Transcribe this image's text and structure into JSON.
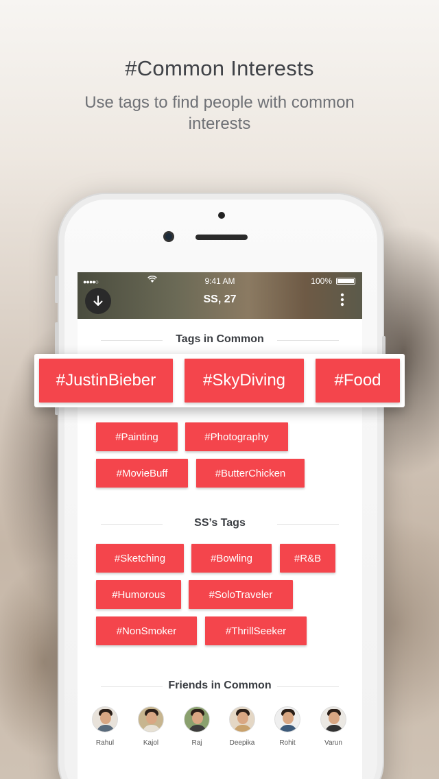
{
  "headline": "#Common Interests",
  "subline": "Use tags to find people with common interests",
  "status_bar": {
    "signal": "●●●●○",
    "time": "9:41 AM",
    "battery": "100%"
  },
  "header": {
    "title": "SS, 27"
  },
  "sections": {
    "common_title": "Tags in Common",
    "user_tags_title": "SS’s Tags",
    "friends_title": "Friends in Common"
  },
  "highlight_tags": [
    "#JustinBieber",
    "#SkyDiving",
    "#Food"
  ],
  "common_tags": [
    "#Painting",
    "#Photography",
    "#MovieBuff",
    "#ButterChicken"
  ],
  "user_tags": [
    "#Sketching",
    "#Bowling",
    "#R&B",
    "#Humorous",
    "#SoloTraveler",
    "#NonSmoker",
    "#ThrillSeeker"
  ],
  "friends": [
    "Rahul",
    "Kajol",
    "Raj",
    "Deepika",
    "Rohit",
    "Varun"
  ],
  "colors": {
    "accent": "#f4454c",
    "heading": "#3f4247"
  }
}
